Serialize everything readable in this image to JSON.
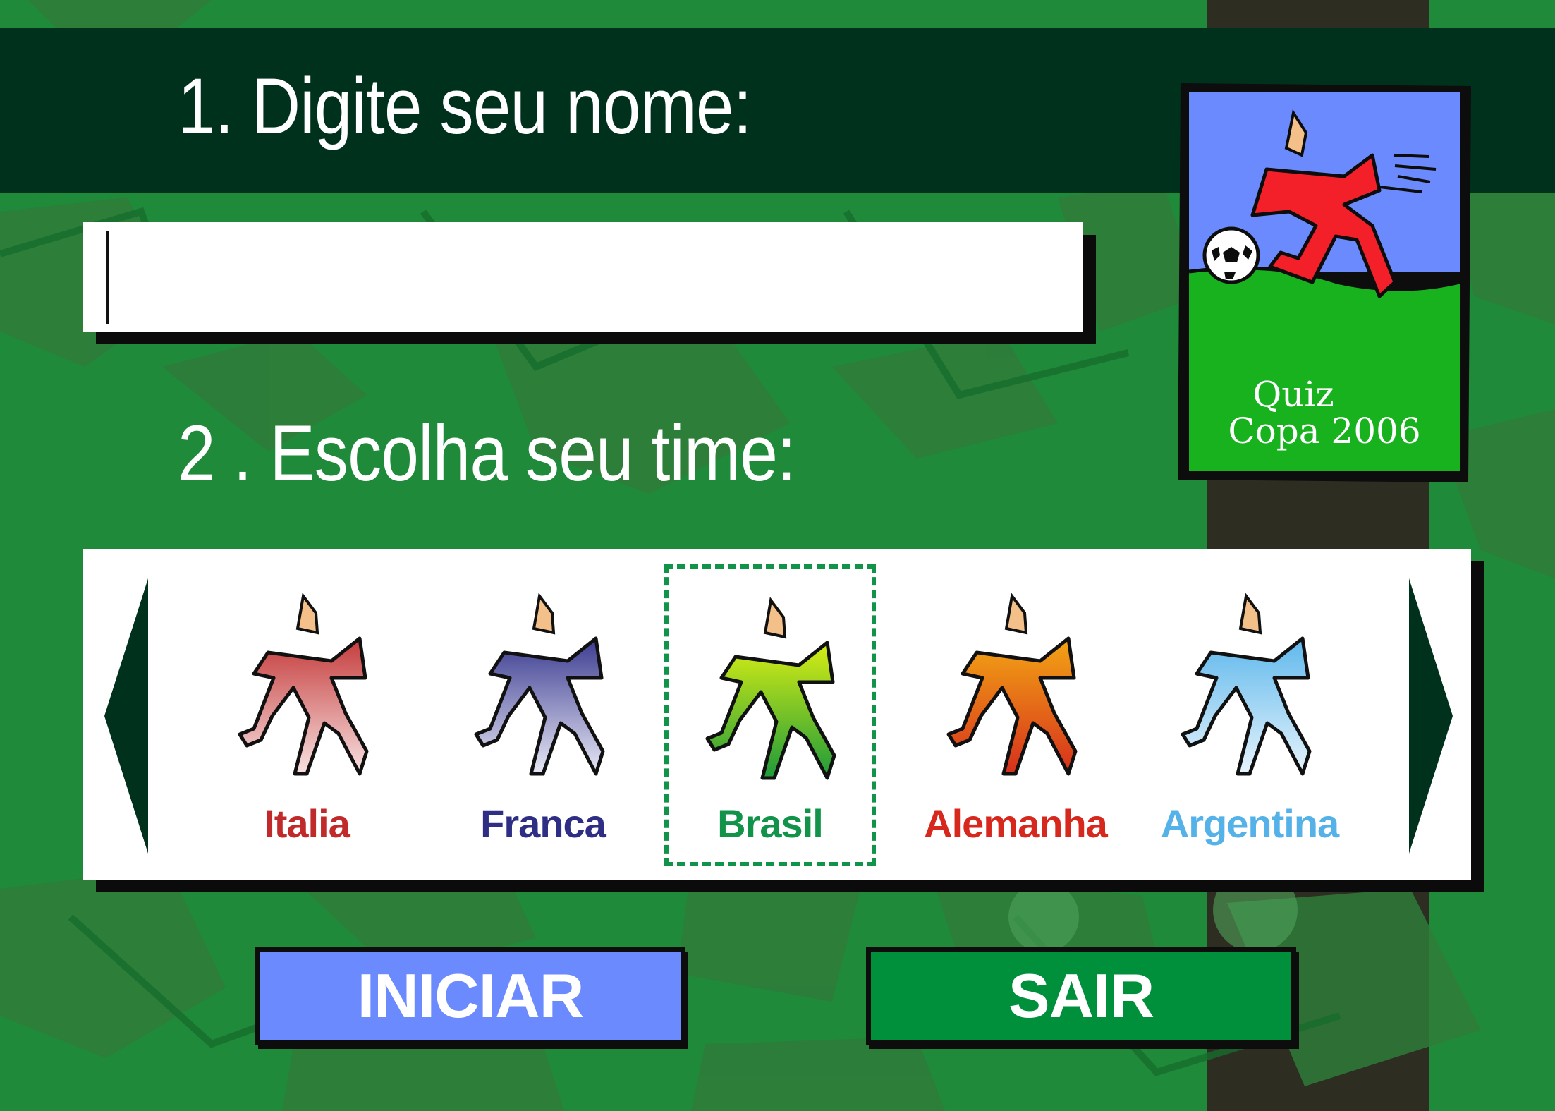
{
  "colors": {
    "background": "#1e8a3a",
    "header_band": "#00311c",
    "start_button": "#6b8afd",
    "exit_button": "#008f3b",
    "selection_outline": "#11944a"
  },
  "step1": {
    "label": "1. Digite seu nome:",
    "input_value": "",
    "input_placeholder": ""
  },
  "step2": {
    "label": "2 . Escolha seu time:"
  },
  "logo": {
    "line1": "Quiz",
    "line2": "Copa 2006"
  },
  "teams": [
    {
      "name": "Italia",
      "color": "#c12a2a",
      "grad_top": "#c53b3b",
      "grad_bottom": "#f8e2e2",
      "selected": false
    },
    {
      "name": "Franca",
      "color": "#2e2e84",
      "grad_top": "#3c3c91",
      "grad_bottom": "#e8e8f6",
      "selected": false
    },
    {
      "name": "Brasil",
      "color": "#11944a",
      "grad_top": "#d8ee14",
      "grad_bottom": "#1e9a3a",
      "selected": true
    },
    {
      "name": "Alemanha",
      "color": "#d7281e",
      "grad_top": "#f3a514",
      "grad_bottom": "#d6301c",
      "selected": false
    },
    {
      "name": "Argentina",
      "color": "#54b2e8",
      "grad_top": "#5fb8ec",
      "grad_bottom": "#e7f4fc",
      "selected": false
    }
  ],
  "icons": {
    "prev": "triangle-left-icon",
    "next": "triangle-right-icon"
  },
  "buttons": {
    "start_label": "INICIAR",
    "exit_label": "SAIR"
  }
}
